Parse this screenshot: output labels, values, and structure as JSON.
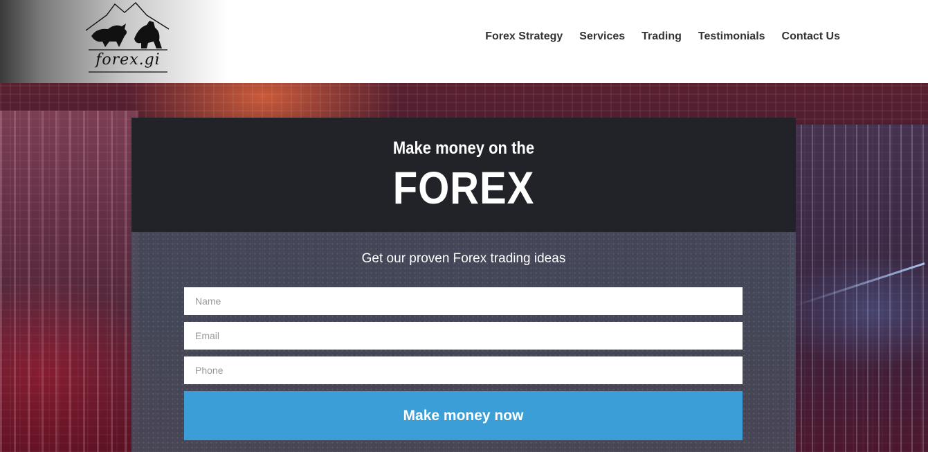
{
  "header": {
    "logo_text": "forex.gi",
    "logo_icon": "bull-and-bear-icon",
    "nav": [
      {
        "label": "Forex Strategy"
      },
      {
        "label": "Services"
      },
      {
        "label": "Trading"
      },
      {
        "label": "Testimonials"
      },
      {
        "label": "Contact Us"
      }
    ]
  },
  "hero": {
    "subtitle": "Make money on the",
    "title": "FOREX",
    "tagline": "Get our proven Forex trading ideas",
    "form": {
      "name_placeholder": "Name",
      "email_placeholder": "Email",
      "phone_placeholder": "Phone",
      "name_value": "",
      "email_value": "",
      "phone_value": "",
      "submit_label": "Make money now"
    }
  },
  "colors": {
    "card_header_bg": "#212328",
    "button_bg": "#3b9ed6",
    "nav_text": "#333333"
  }
}
